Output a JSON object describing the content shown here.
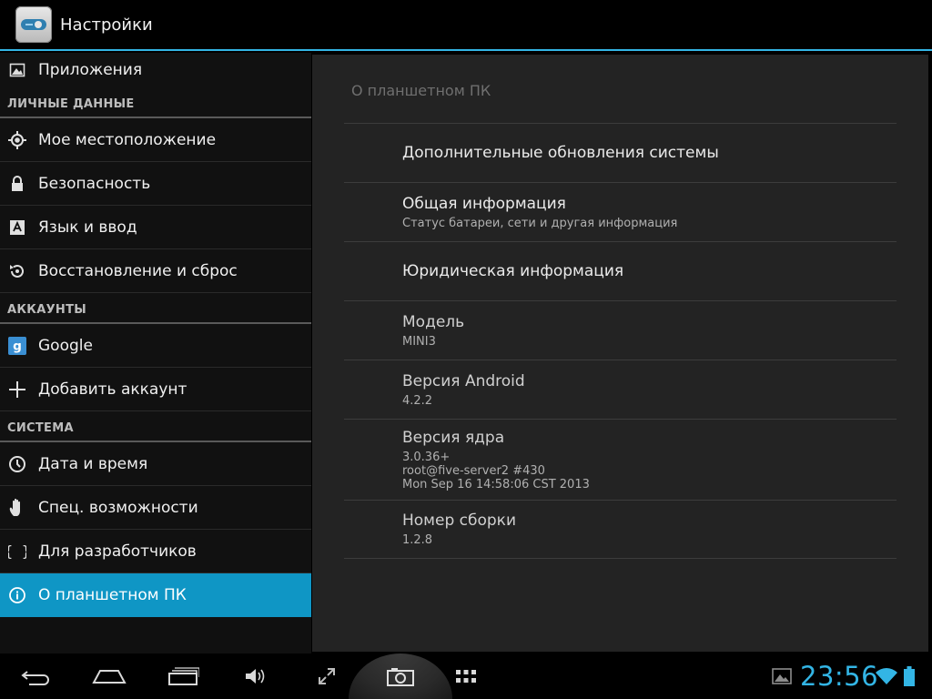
{
  "app": {
    "title": "Настройки"
  },
  "sidebar": {
    "apps_label": "Приложения",
    "sections": {
      "personal": "ЛИЧНЫЕ ДАННЫЕ",
      "accounts": "АККАУНТЫ",
      "system": "СИСТЕМА"
    },
    "items": {
      "location": "Мое местоположение",
      "security": "Безопасность",
      "language": "Язык и ввод",
      "backup": "Восстановление и сброс",
      "google": "Google",
      "add_account": "Добавить аккаунт",
      "datetime": "Дата и время",
      "accessibility": "Спец. возможности",
      "developer": "Для разработчиков",
      "about": "О планшетном ПК"
    }
  },
  "panel": {
    "title": "О планшетном ПК",
    "rows": [
      {
        "title": "Дополнительные обновления системы",
        "sub": ""
      },
      {
        "title": "Общая информация",
        "sub": "Статус батареи, сети и другая информация"
      },
      {
        "title": "Юридическая информация",
        "sub": ""
      },
      {
        "title": "Модель",
        "sub": "MINI3"
      },
      {
        "title": "Версия Android",
        "sub": "4.2.2"
      },
      {
        "title": "Версия ядра",
        "sub1": "3.0.36+",
        "sub2": "root@five-server2 #430",
        "sub3": "Mon Sep 16 14:58:06 CST 2013"
      },
      {
        "title": "Номер сборки",
        "sub": "1.2.8"
      }
    ]
  },
  "status": {
    "time": "23:56"
  },
  "colors": {
    "accent": "#33b5e5",
    "selected": "#0f96c5"
  },
  "icons": [
    "settings-app-icon",
    "apps-icon",
    "location-icon",
    "lock-icon",
    "language-icon",
    "backup-icon",
    "google-icon",
    "plus-icon",
    "clock-icon",
    "hand-icon",
    "braces-icon",
    "info-icon",
    "back-icon",
    "home-icon",
    "recent-apps-icon",
    "volume-icon",
    "expand-icon",
    "camera-icon",
    "app-grid-icon",
    "gallery-icon",
    "wifi-icon",
    "battery-icon"
  ]
}
